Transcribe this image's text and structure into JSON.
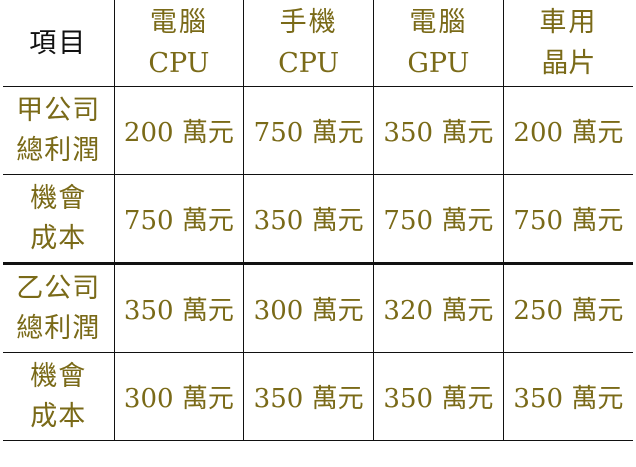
{
  "table": {
    "corner_label": "項目",
    "headers": [
      {
        "top": "電腦",
        "bottom": "CPU"
      },
      {
        "top": "手機",
        "bottom": "CPU"
      },
      {
        "top": "電腦",
        "bottom": "GPU"
      },
      {
        "top": "車用",
        "bottom": "晶片"
      }
    ],
    "rows": [
      {
        "label_top": "甲公司",
        "label_bottom": "總利潤",
        "values": [
          "200 萬元",
          "750 萬元",
          "350 萬元",
          "200 萬元"
        ]
      },
      {
        "label_top": "機會",
        "label_bottom": "成本",
        "values": [
          "750 萬元",
          "350 萬元",
          "750 萬元",
          "750 萬元"
        ]
      },
      {
        "label_top": "乙公司",
        "label_bottom": "總利潤",
        "values": [
          "350 萬元",
          "300 萬元",
          "320 萬元",
          "250 萬元"
        ]
      },
      {
        "label_top": "機會",
        "label_bottom": "成本",
        "values": [
          "300 萬元",
          "350 萬元",
          "350 萬元",
          "350 萬元"
        ]
      }
    ]
  }
}
